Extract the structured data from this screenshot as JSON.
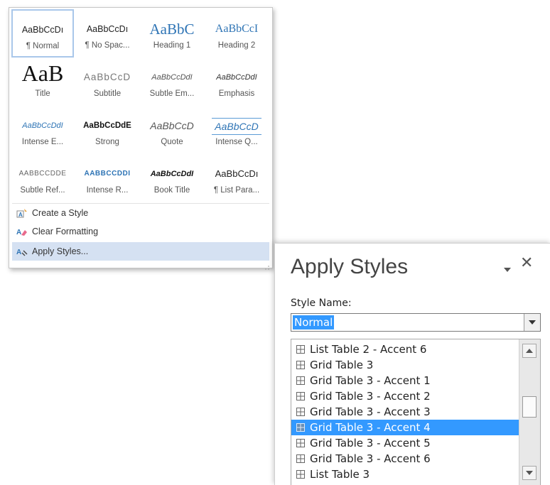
{
  "gallery": {
    "styles": [
      {
        "preview": "AaBbCcDı",
        "caption": "¶ Normal"
      },
      {
        "preview": "AaBbCcDı",
        "caption": "¶ No Spac..."
      },
      {
        "preview": "AaBbC",
        "caption": "Heading 1"
      },
      {
        "preview": "AaBbCcI",
        "caption": "Heading 2"
      },
      {
        "preview": "AaB",
        "caption": "Title"
      },
      {
        "preview": "AaBbCcD",
        "caption": "Subtitle"
      },
      {
        "preview": "AaBbCcDdI",
        "caption": "Subtle Em..."
      },
      {
        "preview": "AaBbCcDdI",
        "caption": "Emphasis"
      },
      {
        "preview": "AaBbCcDdI",
        "caption": "Intense E..."
      },
      {
        "preview": "AaBbCcDdE",
        "caption": "Strong"
      },
      {
        "preview": "AaBbCcD",
        "caption": "Quote"
      },
      {
        "preview": "AaBbCcD",
        "caption": "Intense Q..."
      },
      {
        "preview": "AABBCCDDE",
        "caption": "Subtle Ref..."
      },
      {
        "preview": "AABBCCDDI",
        "caption": "Intense R..."
      },
      {
        "preview": "AaBbCcDdI",
        "caption": "Book Title"
      },
      {
        "preview": "AaBbCcDı",
        "caption": "¶ List Para..."
      }
    ],
    "commands": {
      "create": "Create a Style",
      "clear": "Clear Formatting",
      "apply": "Apply Styles..."
    }
  },
  "pane": {
    "title": "Apply Styles",
    "style_name_label": "Style Name:",
    "style_name_value": "Normal",
    "items": [
      "List Table 2 - Accent 6",
      "Grid Table 3",
      "Grid Table 3 - Accent 1",
      "Grid Table 3 - Accent 2",
      "Grid Table 3 - Accent 3",
      "Grid Table 3 - Accent 4",
      "Grid Table 3 - Accent 5",
      "Grid Table 3 - Accent 6",
      "List Table 3"
    ],
    "selected_item": "Grid Table 3 - Accent 4"
  },
  "colors": {
    "selection": "#3399ff",
    "hover": "#d5e1f2",
    "heading": "#2e74b5"
  }
}
